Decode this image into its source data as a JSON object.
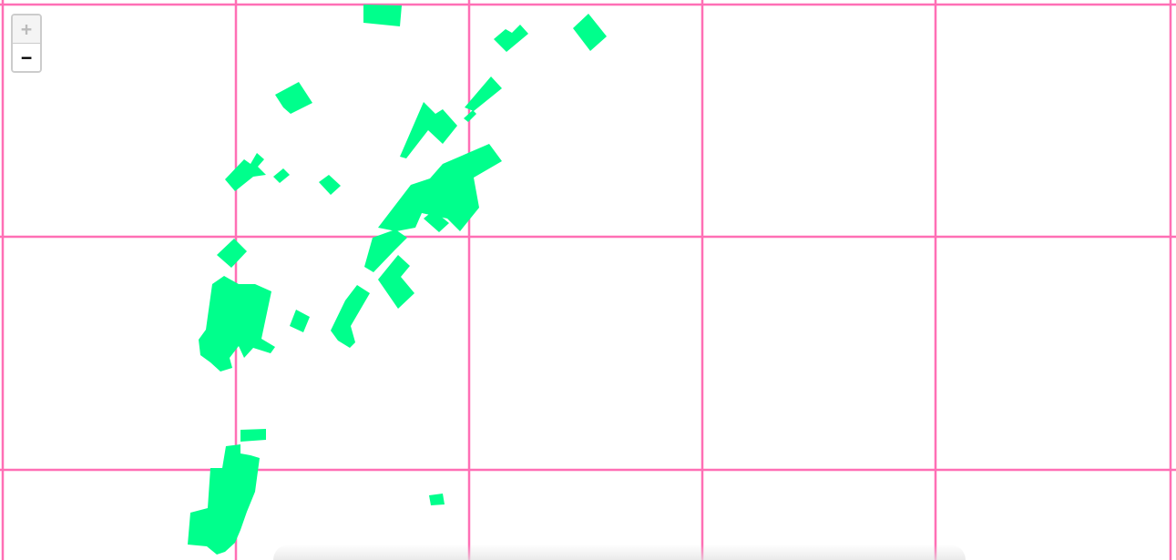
{
  "map": {
    "background_color": "#ffffff",
    "grid_color": "#ff6fb5",
    "feature_color": "#00ff8c",
    "feature_layer": "building-footprints"
  },
  "zoom_control": {
    "zoom_in_label": "+",
    "zoom_out_label": "−",
    "zoom_in_state": "disabled",
    "zoom_out_state": "enabled"
  }
}
